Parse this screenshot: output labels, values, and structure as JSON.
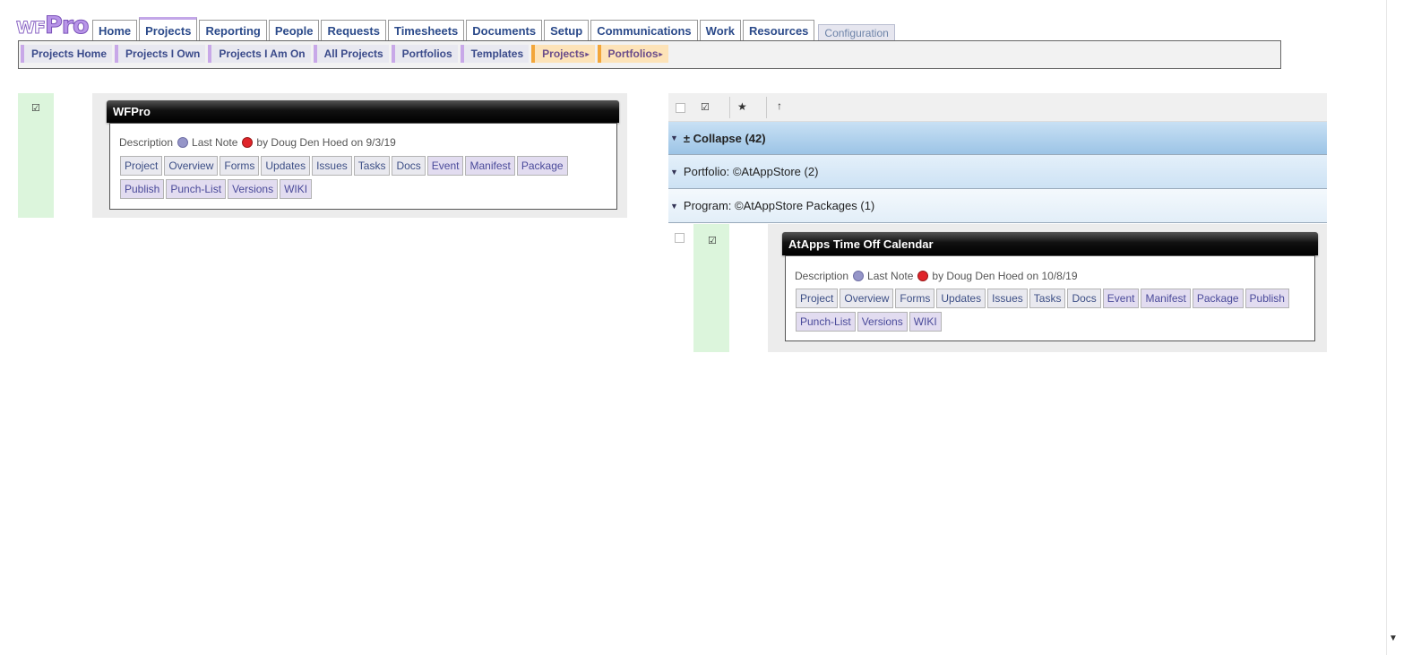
{
  "logo": {
    "wf": "WF",
    "pro": "Pro"
  },
  "tabs": [
    {
      "label": "Home"
    },
    {
      "label": "Projects"
    },
    {
      "label": "Reporting"
    },
    {
      "label": "People"
    },
    {
      "label": "Requests"
    },
    {
      "label": "Timesheets"
    },
    {
      "label": "Documents"
    },
    {
      "label": "Setup"
    },
    {
      "label": "Communications"
    },
    {
      "label": "Work"
    },
    {
      "label": "Resources"
    },
    {
      "label": "Configuration"
    }
  ],
  "subnav": [
    {
      "label": "Projects Home"
    },
    {
      "label": "Projects I Own"
    },
    {
      "label": "Projects I Am On"
    },
    {
      "label": "All Projects"
    },
    {
      "label": "Portfolios"
    },
    {
      "label": "Templates"
    },
    {
      "label": "Projects"
    },
    {
      "label": "Portfolios"
    }
  ],
  "left_card": {
    "title": "WFPro",
    "description_label": "Description",
    "last_note_label": "Last Note",
    "by_text": "by Doug Den Hoed on 9/3/19",
    "buttons": [
      "Project",
      "Overview",
      "Forms",
      "Updates",
      "Issues",
      "Tasks",
      "Docs",
      "Event",
      "Manifest",
      "Package",
      "Publish",
      "Punch-List",
      "Versions",
      "WIKI"
    ]
  },
  "right_panel": {
    "group_collapse": "± Collapse (42)",
    "group_portfolio": "Portfolio: ©AtAppStore (2)",
    "group_program": "Program: ©AtAppStore Packages (1)",
    "card": {
      "title": "AtApps Time Off Calendar",
      "description_label": "Description",
      "last_note_label": "Last Note",
      "by_text": "by Doug Den Hoed on 10/8/19",
      "buttons": [
        "Project",
        "Overview",
        "Forms",
        "Updates",
        "Issues",
        "Tasks",
        "Docs",
        "Event",
        "Manifest",
        "Package",
        "Publish",
        "Punch-List",
        "Versions",
        "WIKI"
      ]
    }
  },
  "icons": {
    "check": "☑",
    "star": "★",
    "sort_up": "↑",
    "caret": "▼",
    "arrow": "▸",
    "scroll_down": "▼"
  }
}
